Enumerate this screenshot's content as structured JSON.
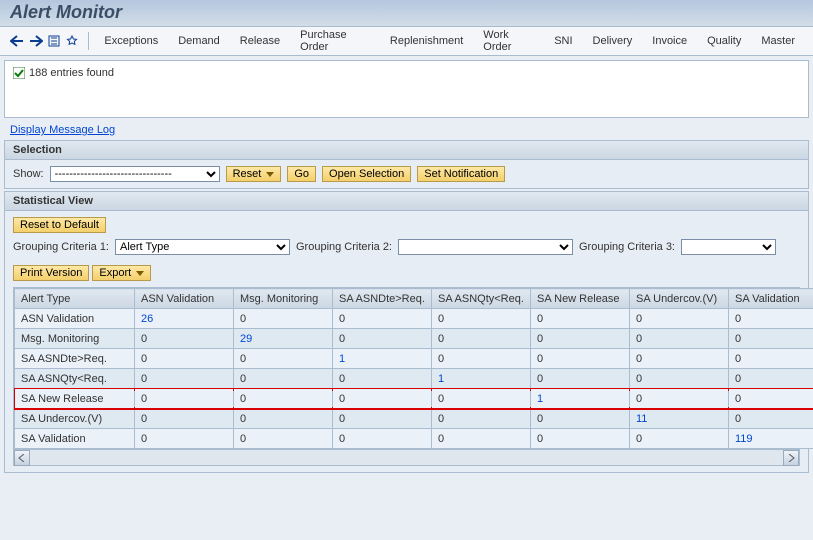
{
  "title": "Alert Monitor",
  "menu": [
    "Exceptions",
    "Demand",
    "Release",
    "Purchase Order",
    "Replenishment",
    "Work Order",
    "SNI",
    "Delivery",
    "Invoice",
    "Quality",
    "Master"
  ],
  "status": "188 entries found",
  "msg_log": "Display Message Log",
  "panel_selection": {
    "title": "Selection",
    "show_label": "Show:",
    "show_value": "--------------------------------",
    "buttons": {
      "reset": "Reset",
      "go": "Go",
      "open": "Open Selection",
      "setnotif": "Set Notification"
    }
  },
  "panel_stat": {
    "title": "Statistical View",
    "reset": "Reset to Default",
    "gc1_label": "Grouping Criteria 1:",
    "gc1_value": "Alert Type",
    "gc2_label": "Grouping Criteria 2:",
    "gc2_value": "",
    "gc3_label": "Grouping Criteria 3:",
    "gc3_value": "",
    "print": "Print Version",
    "export": "Export"
  },
  "table": {
    "headers": [
      "Alert Type",
      "ASN Validation",
      "Msg. Monitoring",
      "SA ASNDte>Req.",
      "SA ASNQty<Req.",
      "SA New Release",
      "SA Undercov.(V)",
      "SA Validation"
    ],
    "rows": [
      {
        "type": "ASN Validation",
        "cells": [
          "26",
          "0",
          "0",
          "0",
          "0",
          "0",
          "0"
        ],
        "links": [
          0
        ]
      },
      {
        "type": "Msg. Monitoring",
        "cells": [
          "0",
          "29",
          "0",
          "0",
          "0",
          "0",
          "0"
        ],
        "links": [
          1
        ]
      },
      {
        "type": "SA ASNDte>Req.",
        "cells": [
          "0",
          "0",
          "1",
          "0",
          "0",
          "0",
          "0"
        ],
        "links": [
          2
        ]
      },
      {
        "type": "SA ASNQty<Req.",
        "cells": [
          "0",
          "0",
          "0",
          "1",
          "0",
          "0",
          "0"
        ],
        "links": [
          3
        ]
      },
      {
        "type": "SA New Release",
        "cells": [
          "0",
          "0",
          "0",
          "0",
          "1",
          "0",
          "0"
        ],
        "links": [
          4
        ],
        "highlight": true
      },
      {
        "type": "SA Undercov.(V)",
        "cells": [
          "0",
          "0",
          "0",
          "0",
          "0",
          "11",
          "0"
        ],
        "links": [
          5
        ]
      },
      {
        "type": "SA Validation",
        "cells": [
          "0",
          "0",
          "0",
          "0",
          "0",
          "0",
          "119"
        ],
        "links": [
          6
        ]
      }
    ]
  }
}
